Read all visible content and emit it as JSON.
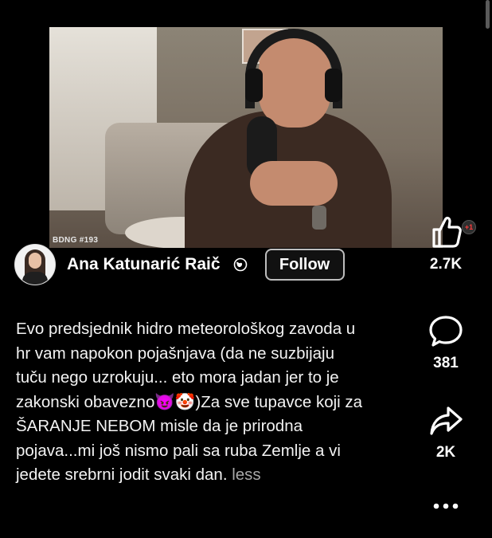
{
  "video": {
    "watermark_left": "BDNG",
    "watermark_mid": "",
    "watermark_right": "#193"
  },
  "author": {
    "name": "Ana Katunarić Raič",
    "follow_label": "Follow",
    "privacy_icon": "globe-icon"
  },
  "caption": {
    "text": "Evo predsjednik hidro meteorološkog zavoda u hr vam napokon pojašnjava (da ne suzbijaju tuču nego uzrokuju... eto mora jadan jer to je zakonski obavezno😈🤡)Za sve tupavce koji za ŠARANJE NEBOM misle da je prirodna pojava...mi još nismo pali sa ruba Zemlje a vi jedete srebrni jodit svaki dan.",
    "less_label": "less"
  },
  "actions": {
    "like_icon": "thumbs-up-icon",
    "like_badge": "+1",
    "like_count": "2.7K",
    "comment_icon": "comment-bubble-icon",
    "comment_count": "381",
    "share_icon": "share-arrow-icon",
    "share_count": "2K",
    "more_icon": "more-dots-icon"
  },
  "colors": {
    "background": "#000000",
    "text": "#ffffff",
    "muted": "#a8a8a8",
    "follow_border": "#bdbdbd",
    "badge_red": "#ff3d3d"
  }
}
